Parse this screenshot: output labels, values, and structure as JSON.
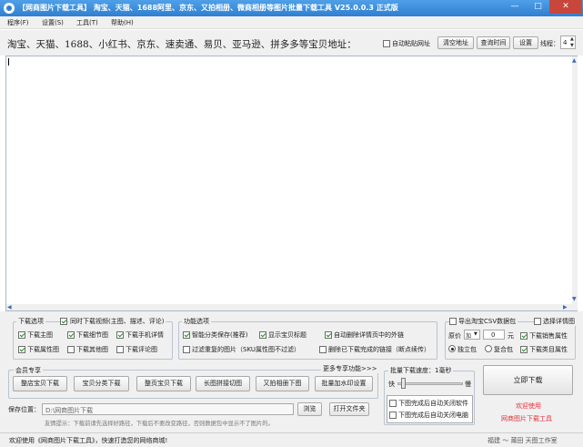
{
  "window": {
    "title": "【网商图片下载工具】 淘宝、天猫、1688阿里、京东、又拍相册、微商相册等图片批量下载工具 V25.0.0.3 正式版",
    "minimize": "—",
    "maximize": "□",
    "close": "✕"
  },
  "menu": {
    "items": [
      "程序(F)",
      "设置(S)",
      "工具(T)",
      "帮助(H)"
    ]
  },
  "toolbar": {
    "address_label": "淘宝、天猫、1688、小红书、京东、速卖通、易贝、亚马逊、拼多多等宝贝地址：",
    "auto_paste": "自动粘贴网址",
    "clear_address": "清空地址",
    "query_time": "查询时间",
    "settings": "设置",
    "threads_label": "线程：",
    "threads_value": "4"
  },
  "download_options": {
    "legend": "下载选项",
    "video_check": "同时下载视频(主图、描述、评论)",
    "items": [
      {
        "label": "下载主图",
        "checked": true
      },
      {
        "label": "下载细节图",
        "checked": true
      },
      {
        "label": "下载手机详情",
        "checked": true
      },
      {
        "label": "下载属性图",
        "checked": true
      },
      {
        "label": "下载其他图",
        "checked": false
      },
      {
        "label": "下载评论图",
        "checked": false
      }
    ]
  },
  "function_options": {
    "legend": "功能选项",
    "items": [
      {
        "label": "智能分类保存(推荐)",
        "checked": true
      },
      {
        "label": "显示宝贝标题",
        "checked": true
      },
      {
        "label": "自动删除详情页中的外链",
        "checked": true
      },
      {
        "label": "过滤重复的图片（SKU属性图不过滤）",
        "checked": false
      },
      {
        "label": "删除已下载完成的链接（断点续传）",
        "checked": false
      }
    ]
  },
  "csv_options": {
    "export_csv": "导出淘宝CSV数据包",
    "select_detail": "选择详情图",
    "price_label": "原价",
    "price_op": "加",
    "price_value": "0",
    "price_unit": "元",
    "sales_attr": "下载销售属性",
    "standalone": "独立包",
    "merge": "复合包",
    "category_attr": "下载类目属性"
  },
  "member": {
    "legend": "会员专享",
    "more": "更多专享功能>>>",
    "buttons": [
      "整店宝贝下载",
      "宝贝分类下载",
      "整页宝贝下载",
      "长图拼接切图",
      "又拍相册下图",
      "批量加水印设置"
    ]
  },
  "speed": {
    "legend": "批量下载速度：1毫秒",
    "fast": "快",
    "slow": "慢",
    "level": 0.08,
    "close_after": "下图完成后自动关闭软件",
    "shutdown_after": "下图完成后自动关闭电脑"
  },
  "download_now": "立即下载",
  "welcome": {
    "line1": "欢迎使用",
    "line2": "网商图片下载工具"
  },
  "save": {
    "label": "保存位置：",
    "path": "D:\\网商图片下载",
    "browse": "浏览",
    "open_folder": "打开文件夹",
    "tip": "友情提示：下载前请先选择好路径，下载后不要改变路径，否则数据包中显示不了图片的。"
  },
  "status": {
    "left": "欢迎使用《网商图片下载工具》，快速打造您的网络商城!",
    "right": "福建 ～ 莆田 天图工作室"
  }
}
